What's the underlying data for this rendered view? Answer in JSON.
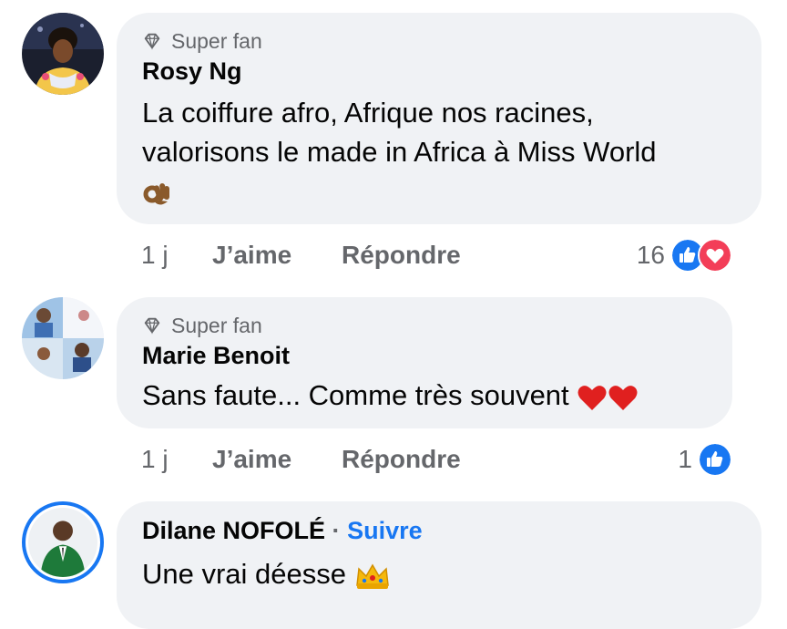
{
  "comments": [
    {
      "badge": "Super fan",
      "author": "Rosy Ng",
      "text_line1": "La coiffure afro, Afrique nos racines,",
      "text_line2": "valorisons le made in Africa à Miss World",
      "time": "1 j",
      "like_label": "J’aime",
      "reply_label": "Répondre",
      "reaction_count": "16",
      "reactions": [
        "like-icon",
        "love-icon"
      ],
      "emoji": "ok-hand-icon"
    },
    {
      "badge": "Super fan",
      "author": "Marie Benoit",
      "text": "Sans faute... Comme très souvent",
      "time": "1 j",
      "like_label": "J’aime",
      "reply_label": "Répondre",
      "reaction_count": "1",
      "reactions": [
        "like-icon"
      ],
      "emoji": [
        "heart-icon",
        "heart-icon"
      ]
    },
    {
      "author": "Dilane NOFOLÉ",
      "separator": "·",
      "follow_label": "Suivre",
      "text": "Une vrai déesse",
      "emoji": "crown-icon"
    }
  ],
  "colors": {
    "bubble": "#f0f2f5",
    "secondary_text": "#65676b",
    "link_blue": "#1877f2",
    "like_blue": "#1877f2",
    "love_red": "#f33e58"
  }
}
